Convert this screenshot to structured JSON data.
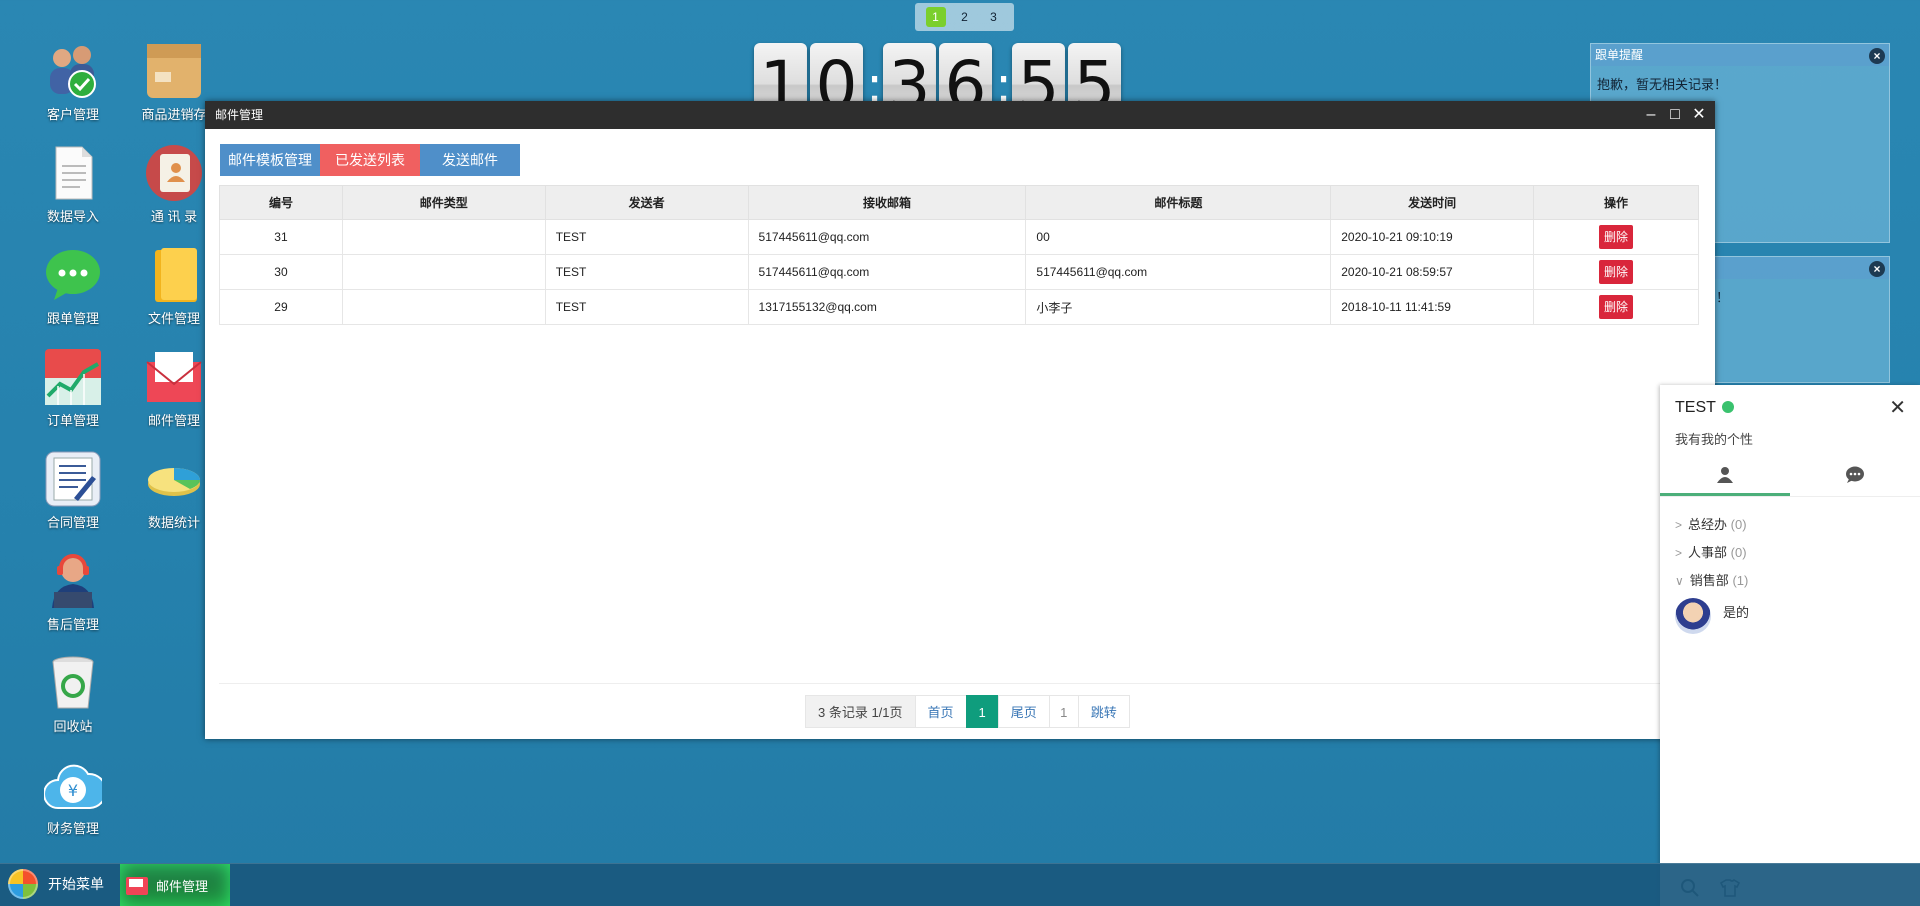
{
  "desktop": {
    "icons_left": [
      "客户管理",
      "数据导入",
      "跟单管理",
      "订单管理",
      "合同管理",
      "售后管理",
      "回收站",
      "财务管理"
    ],
    "icons_right": [
      "商品进销存",
      "通 讯 录",
      "文件管理",
      "邮件管理",
      "数据统计"
    ]
  },
  "page_switcher": {
    "pages": [
      "1",
      "2",
      "3"
    ],
    "active": "1"
  },
  "clock": {
    "h1": "1",
    "h2": "0",
    "m1": "3",
    "m2": "6",
    "s1": "5",
    "s2": "5",
    "sep": ":"
  },
  "reminders": [
    {
      "title": "跟单提醒",
      "body": "抱歉，暂无相关记录！"
    },
    {
      "title": "",
      "body": "！"
    }
  ],
  "window": {
    "title": "邮件管理",
    "controls": {
      "minimize": "–",
      "maximize": "□",
      "close": "✕"
    },
    "tabs": [
      "邮件模板管理",
      "已发送列表",
      "发送邮件"
    ],
    "table": {
      "headers": [
        "编号",
        "邮件类型",
        "发送者",
        "接收邮箱",
        "邮件标题",
        "发送时间",
        "操作"
      ],
      "rows": [
        {
          "id": "31",
          "type": "",
          "sender": "TEST",
          "to": "517445611@qq.com",
          "subject": "00",
          "time": "2020-10-21 09:10:19",
          "action": "删除"
        },
        {
          "id": "30",
          "type": "",
          "sender": "TEST",
          "to": "517445611@qq.com",
          "subject": "517445611@qq.com",
          "time": "2020-10-21 08:59:57",
          "action": "删除"
        },
        {
          "id": "29",
          "type": "",
          "sender": "TEST",
          "to": "1317155132@qq.com",
          "subject": "小李子",
          "time": "2018-10-11 11:41:59",
          "action": "删除"
        }
      ]
    },
    "pagination": {
      "info": "3 条记录 1/1页",
      "first": "首页",
      "current": "1",
      "last": "尾页",
      "jump_value": "1",
      "jump": "跳转"
    }
  },
  "chat": {
    "user": "TEST",
    "signature": "我有我的个性",
    "close": "✕",
    "groups": [
      {
        "name": "总经办",
        "count": "(0)",
        "arrow": ">"
      },
      {
        "name": "人事部",
        "count": "(0)",
        "arrow": ">"
      },
      {
        "name": "销售部",
        "count": "(1)",
        "arrow": "∨"
      }
    ],
    "friend": {
      "name": "是的"
    }
  },
  "taskbar": {
    "start_label": "开始菜单",
    "task_label": "邮件管理"
  }
}
